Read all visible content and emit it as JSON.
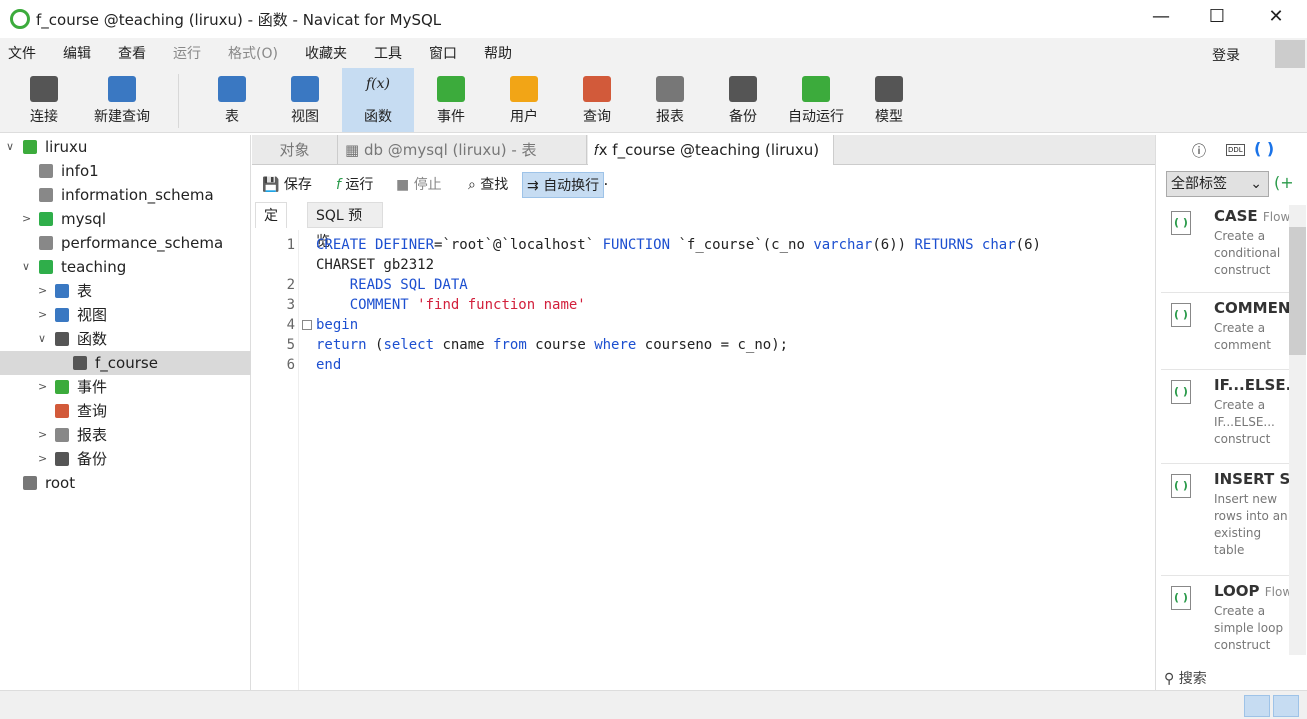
{
  "window": {
    "title": "f_course @teaching (liruxu) - 函数 - Navicat for MySQL",
    "minimize": "—",
    "maximize": "☐",
    "close": "✕"
  },
  "menu": [
    "文件",
    "编辑",
    "查看",
    "运行",
    "格式(O)",
    "收藏夹",
    "工具",
    "窗口",
    "帮助"
  ],
  "login": "登录",
  "toolbar": [
    {
      "label": "连接",
      "color": "#555"
    },
    {
      "label": "新建查询",
      "color": "#3a78c2"
    },
    {
      "label": "表",
      "color": "#3a78c2"
    },
    {
      "label": "视图",
      "color": "#3a78c2"
    },
    {
      "label": "函数",
      "color": "#555"
    },
    {
      "label": "事件",
      "color": "#3cab3c"
    },
    {
      "label": "用户",
      "color": "#f2a516"
    },
    {
      "label": "查询",
      "color": "#d25a3a"
    },
    {
      "label": "报表",
      "color": "#777"
    },
    {
      "label": "备份",
      "color": "#555"
    },
    {
      "label": "自动运行",
      "color": "#3cab3c"
    },
    {
      "label": "模型",
      "color": "#555"
    }
  ],
  "tree": [
    {
      "label": "liruxu",
      "arrow": "∨",
      "indent": 0,
      "icon": "connection-icon",
      "color": "#3cab3c"
    },
    {
      "label": "info1",
      "arrow": "",
      "indent": 1,
      "icon": "database-icon",
      "color": "#888"
    },
    {
      "label": "information_schema",
      "arrow": "",
      "indent": 1,
      "icon": "database-icon",
      "color": "#888"
    },
    {
      "label": "mysql",
      "arrow": ">",
      "indent": 1,
      "icon": "database-icon",
      "color": "#2fae4a"
    },
    {
      "label": "performance_schema",
      "arrow": "",
      "indent": 1,
      "icon": "database-icon",
      "color": "#888"
    },
    {
      "label": "teaching",
      "arrow": "∨",
      "indent": 1,
      "icon": "database-icon",
      "color": "#2fae4a"
    },
    {
      "label": "表",
      "arrow": ">",
      "indent": 2,
      "icon": "table-icon",
      "color": "#3a78c2"
    },
    {
      "label": "视图",
      "arrow": ">",
      "indent": 2,
      "icon": "view-icon",
      "color": "#3a78c2"
    },
    {
      "label": "函数",
      "arrow": "∨",
      "indent": 2,
      "icon": "function-icon",
      "color": "#555"
    },
    {
      "label": "f_course",
      "arrow": "",
      "indent": 3,
      "icon": "function-icon",
      "color": "#555",
      "selected": true
    },
    {
      "label": "事件",
      "arrow": ">",
      "indent": 2,
      "icon": "event-icon",
      "color": "#3cab3c"
    },
    {
      "label": "查询",
      "arrow": "",
      "indent": 2,
      "icon": "query-icon",
      "color": "#d25a3a"
    },
    {
      "label": "报表",
      "arrow": ">",
      "indent": 2,
      "icon": "report-icon",
      "color": "#888"
    },
    {
      "label": "备份",
      "arrow": ">",
      "indent": 2,
      "icon": "backup-icon",
      "color": "#555"
    },
    {
      "label": "root",
      "arrow": "",
      "indent": 0,
      "icon": "connection-icon",
      "color": "#777"
    }
  ],
  "tabs": [
    {
      "label": "对象"
    },
    {
      "label": "▦ db @mysql (liruxu) - 表"
    },
    {
      "label": "𝑓x f_course @teaching (liruxu) ..."
    }
  ],
  "editor_toolbar": {
    "save": "保存",
    "run": "运行",
    "stop": "停止",
    "find": "查找",
    "wrap": "自动换行"
  },
  "subtabs": [
    "定义",
    "SQL 预览"
  ],
  "code": {
    "line_numbers": [
      "1",
      "",
      "2",
      "3",
      "4",
      "5",
      "6"
    ],
    "lines": [
      [
        [
          "k",
          "CREATE DEFINER"
        ],
        [
          "",
          "=`root`@`localhost` "
        ],
        [
          "k",
          "FUNCTION"
        ],
        [
          "",
          " `f_course`(c_no "
        ],
        [
          "k",
          "varchar"
        ],
        [
          "",
          "(6)) "
        ],
        [
          "k",
          "RETURNS char"
        ],
        [
          "",
          "(6)"
        ]
      ],
      [
        [
          "",
          "CHARSET gb2312"
        ]
      ],
      [
        [
          "k",
          "    READS SQL DATA"
        ]
      ],
      [
        [
          "k",
          "    COMMENT "
        ],
        [
          "s",
          "'find function name'"
        ]
      ],
      [
        [
          "k",
          "begin"
        ]
      ],
      [
        [
          "k",
          "return"
        ],
        [
          "",
          " ("
        ],
        [
          "k",
          "select"
        ],
        [
          "",
          " cname "
        ],
        [
          "k",
          "from"
        ],
        [
          "",
          " course "
        ],
        [
          "k",
          "where"
        ],
        [
          "",
          " courseno = c_no);"
        ]
      ],
      [
        [
          "k",
          "end"
        ]
      ]
    ]
  },
  "right_panel": {
    "filter": "全部标签",
    "search": "搜索",
    "snippets": [
      {
        "title": "CASE",
        "tag": "Flow",
        "desc": "Create a conditional construct"
      },
      {
        "title": "COMMENT",
        "tag": "",
        "desc": "Create a comment"
      },
      {
        "title": "IF...ELSE...",
        "tag": "",
        "desc": "Create a IF...ELSE... construct"
      },
      {
        "title": "INSERT Syntax",
        "tag": "",
        "desc": "Insert new rows into an existing table"
      },
      {
        "title": "LOOP",
        "tag": "Flow",
        "desc": "Create a simple loop construct"
      }
    ]
  }
}
